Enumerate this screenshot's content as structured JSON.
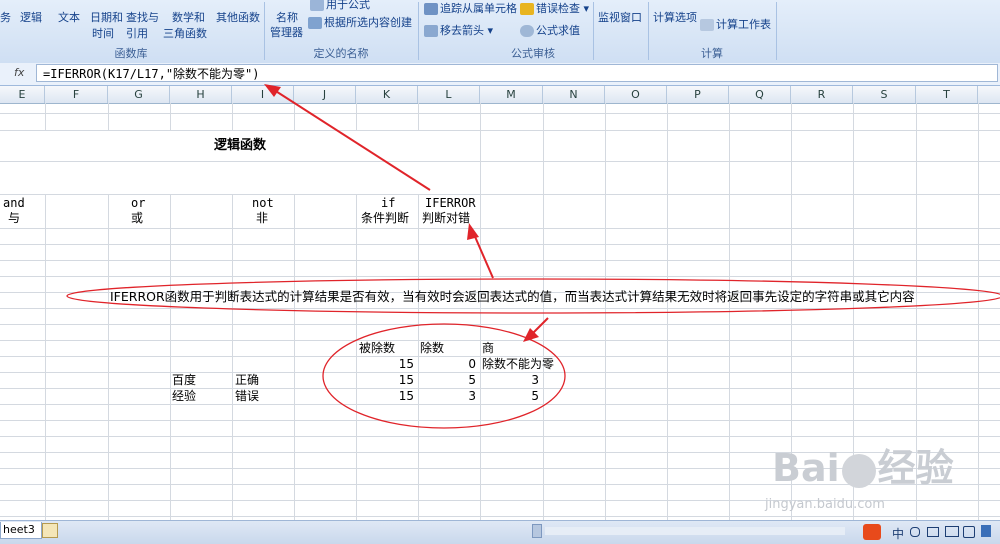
{
  "ribbon": {
    "btn_partial_left": "务",
    "btn_logic": "逻辑",
    "btn_text": "文本",
    "btn_datetime_1": "日期和",
    "btn_datetime_2": "时间",
    "btn_lookup_1": "查找与",
    "btn_lookup_2": "引用",
    "btn_math_1": "数学和",
    "btn_math_2": "三角函数",
    "btn_other": "其他函数",
    "group_function_library": "函数库",
    "btn_name_manager_1": "名称",
    "btn_name_manager_2": "管理器",
    "btn_use_in_formula": "用于公式",
    "btn_create_from_selection": "根据所选内容创建",
    "group_defined_names": "定义的名称",
    "btn_trace_precedents": "追踪从属单元格",
    "btn_error_checking": "错误检查",
    "btn_remove_arrows": "移去箭头",
    "btn_evaluate_formula": "公式求值",
    "btn_watch_window": "监视窗口",
    "group_formula_auditing": "公式审核",
    "btn_calc_options": "计算选项",
    "btn_calc_sheet": "计算工作表",
    "group_calculation": "计算"
  },
  "formula_bar": {
    "fx": "fx",
    "formula": "=IFERROR(K17/L17,\"除数不能为零\")"
  },
  "columns": [
    "E",
    "F",
    "G",
    "H",
    "I",
    "J",
    "K",
    "L",
    "M",
    "N",
    "O",
    "P",
    "Q",
    "R",
    "S",
    "T"
  ],
  "sheet": {
    "title": "逻辑函数",
    "and_en": "and",
    "and_cn": "与",
    "or_en": "or",
    "or_cn": "或",
    "not_en": "not",
    "not_cn": "非",
    "if_en": "if",
    "if_cn": "条件判断",
    "iferror_en": "IFERROR",
    "iferror_cn": "判断对错",
    "note": "IFERROR函数用于判断表达式的计算结果是否有效，当有效时会返回表达式的值，而当表达式计算结果无效时将返回事先设定的字符串或其它内容",
    "hdr_dividend": "被除数",
    "hdr_divisor": "除数",
    "hdr_quotient": "商",
    "r1_k": "15",
    "r1_l": "0",
    "r1_m": "除数不能为零",
    "r2_h": "百度",
    "r2_i": "正确",
    "r2_k": "15",
    "r2_l": "5",
    "r2_m": "3",
    "r3_h": "经验",
    "r3_i": "错误",
    "r3_k": "15",
    "r3_l": "3",
    "r3_m": "5"
  },
  "tabs": {
    "sheet3": "heet3"
  },
  "watermark": {
    "brand": "Bai",
    "brand_cn": "经验",
    "url": "jingyan.baidu.com"
  },
  "tray": {
    "ime": "中"
  },
  "colors": {
    "annotation": "#e0242a",
    "ribbon_text": "#15428b"
  }
}
